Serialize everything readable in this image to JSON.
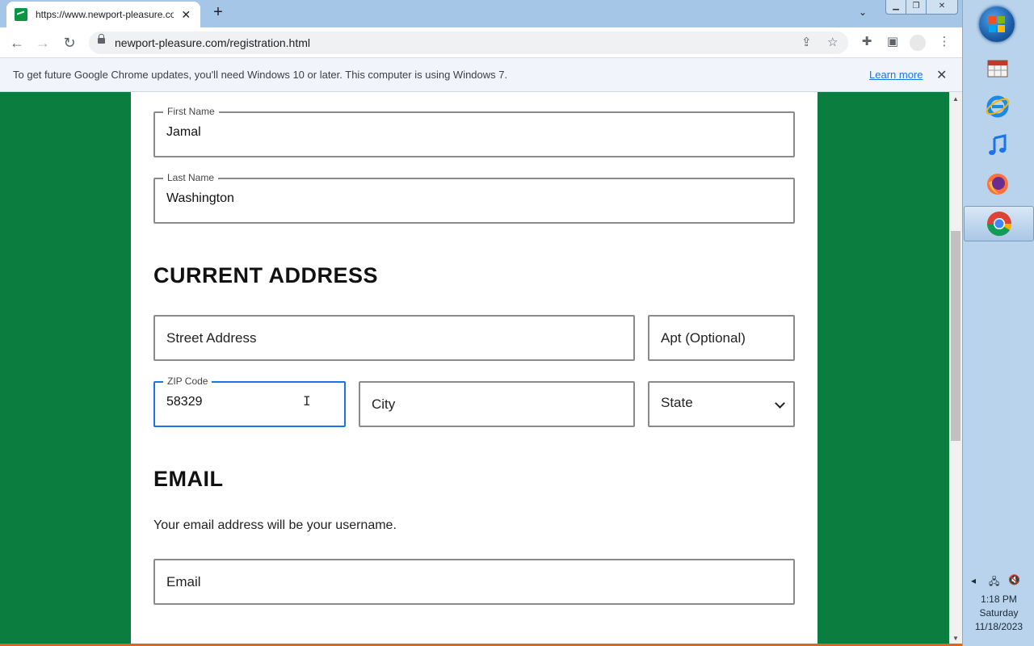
{
  "browser": {
    "tab_title": "https://www.newport-pleasure.com/registration.html",
    "tab_close": "✕",
    "new_tab": "+",
    "url": "newport-pleasure.com/registration.html",
    "infobar_message": "To get future Google Chrome updates, you'll need Windows 10 or later. This computer is using Windows 7.",
    "infobar_link": "Learn more",
    "infobar_close": "✕"
  },
  "form": {
    "first_name": {
      "label": "First Name",
      "value": "Jamal"
    },
    "last_name": {
      "label": "Last Name",
      "value": "Washington"
    },
    "address_heading": "CURRENT ADDRESS",
    "street_placeholder": "Street Address",
    "apt_placeholder": "Apt (Optional)",
    "zip": {
      "label": "ZIP Code",
      "value": "58329"
    },
    "city_placeholder": "City",
    "state_selected": "State",
    "email_heading": "EMAIL",
    "email_helper": "Your email address will be your username.",
    "email_placeholder": "Email"
  },
  "taskbar": {
    "apps": [
      "calendar-app-icon",
      "internet-explorer-icon",
      "itunes-icon",
      "firefox-icon",
      "chrome-icon"
    ],
    "time": "1:18 PM",
    "day": "Saturday",
    "date": "11/18/2023"
  },
  "colors": {
    "page_background": "#0b7d3e",
    "focus_border": "#1a73e8",
    "link": "#1a73e8"
  }
}
